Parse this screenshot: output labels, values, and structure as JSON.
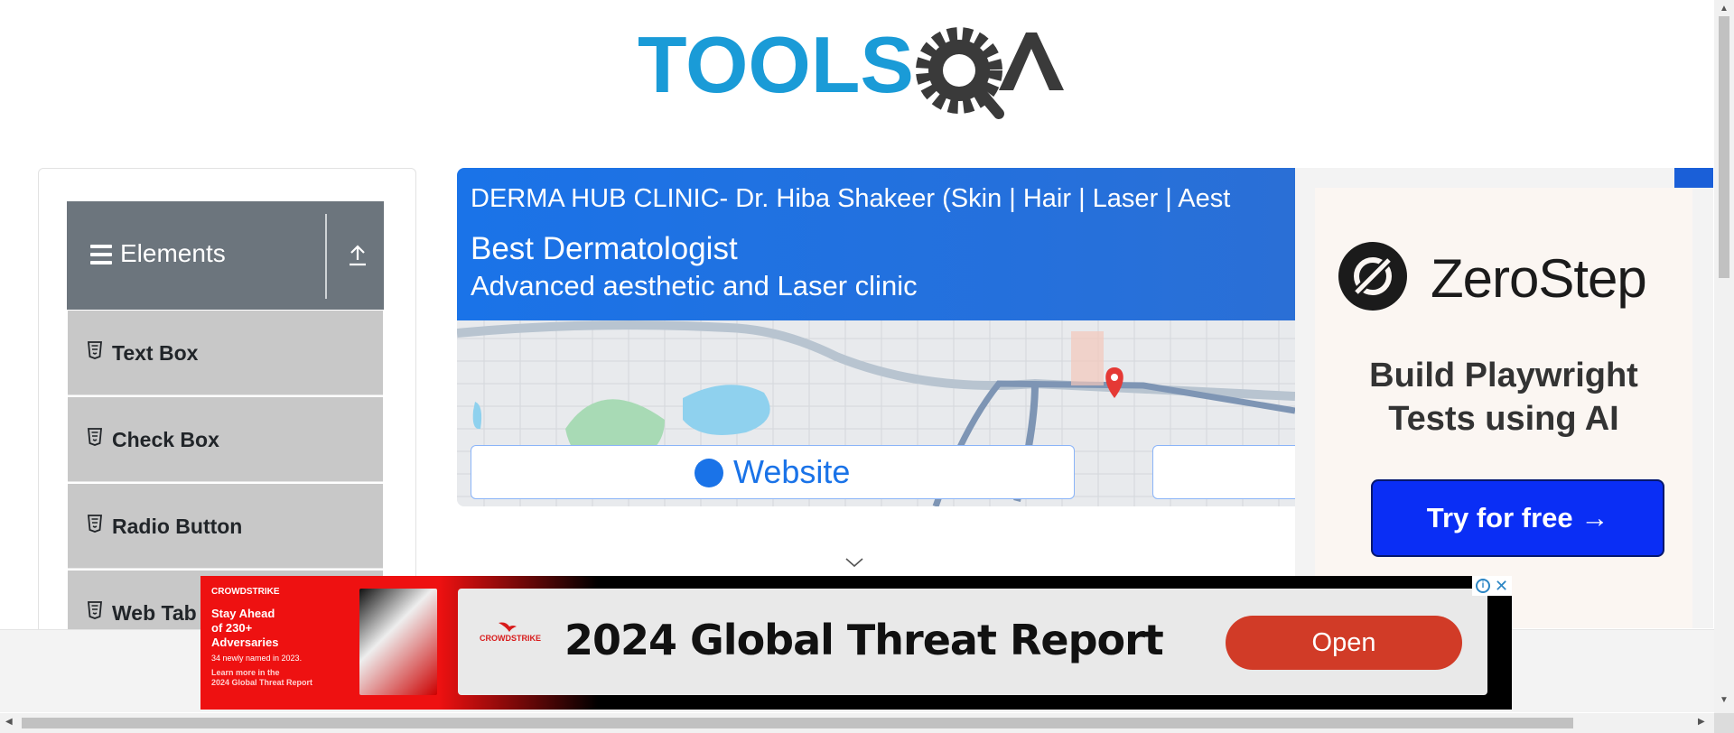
{
  "header": {
    "logo_text": "TOOLSQA"
  },
  "sidebar": {
    "group_title": "Elements",
    "items": [
      {
        "label": "Text Box"
      },
      {
        "label": "Check Box"
      },
      {
        "label": "Radio Button"
      },
      {
        "label": "Web Tab"
      }
    ]
  },
  "clinic_ad": {
    "name": "DERMA HUB CLINIC- Dr. Hiba Shakeer (Skin | Hair | Laser | Aest",
    "tagline": "Best Dermatologist",
    "subtitle": "Advanced aesthetic and Laser clinic",
    "website_label": "Website"
  },
  "side_ad": {
    "brand": "ZeroStep",
    "headline_line1": "Build Playwright",
    "headline_line2": "Tests using AI",
    "cta": "Try for free →"
  },
  "banner_ad": {
    "brand_small": "CROWDSTRIKE",
    "promo_line1": "Stay Ahead",
    "promo_line2": "of 230+",
    "promo_line3": "Adversaries",
    "promo_note": "34 newly named in 2023.",
    "promo_link1": "Learn more in the",
    "promo_link2": "2024 Global Threat Report",
    "logo_text": "CROWDSTRIKE",
    "title": "2024 Global Threat Report",
    "button": "Open"
  },
  "colors": {
    "logo_blue": "#1a9bd7",
    "logo_dark": "#3a3a3a",
    "sidebar_header": "#6c757d",
    "menu_item_bg": "#c8c8c8",
    "clinic_blue": "#1a73e8",
    "zerostep_cta": "#0a2ef5",
    "crowdstrike_red": "#d13b27"
  }
}
